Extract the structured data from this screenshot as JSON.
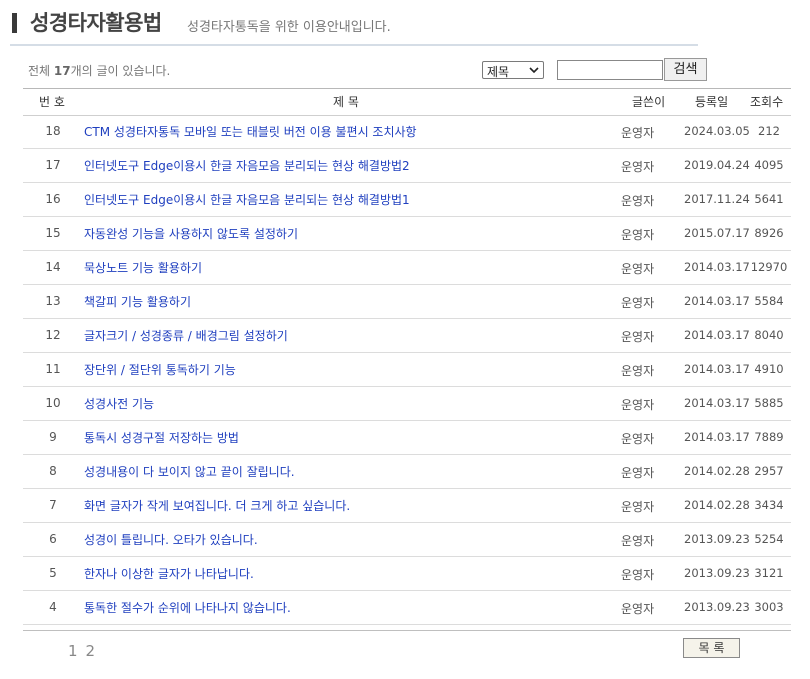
{
  "header": {
    "title": "성경타자활용법",
    "subtitle": "성경타자통독을 위한 이용안내입니다."
  },
  "count": {
    "prefix": "전체 ",
    "number": "17",
    "suffix": "개의 글이 있습니다."
  },
  "search": {
    "field_selected": "제목",
    "input_value": "",
    "button_label": "검색"
  },
  "table": {
    "headers": {
      "num": "번 호",
      "title": "제 목",
      "author": "글쓴이",
      "date": "등록일",
      "hits": "조회수"
    },
    "rows": [
      {
        "num": "18",
        "title": "CTM 성경타자통독 모바일 또는 태블릿 버전 이용 불편시 조치사항",
        "author": "운영자",
        "date": "2024.03.05",
        "hits": "212"
      },
      {
        "num": "17",
        "title": "인터넷도구 Edge이용시 한글 자음모음 분리되는 현상 해결방법2",
        "author": "운영자",
        "date": "2019.04.24",
        "hits": "4095"
      },
      {
        "num": "16",
        "title": "인터넷도구 Edge이용시 한글 자음모음 분리되는 현상 해결방법1",
        "author": "운영자",
        "date": "2017.11.24",
        "hits": "5641"
      },
      {
        "num": "15",
        "title": "자동완성 기능을 사용하지 않도록 설정하기",
        "author": "운영자",
        "date": "2015.07.17",
        "hits": "8926"
      },
      {
        "num": "14",
        "title": "묵상노트 기능 활용하기",
        "author": "운영자",
        "date": "2014.03.17",
        "hits": "12970"
      },
      {
        "num": "13",
        "title": "책갈피 기능 활용하기",
        "author": "운영자",
        "date": "2014.03.17",
        "hits": "5584"
      },
      {
        "num": "12",
        "title": "글자크기 / 성경종류 / 배경그림 설정하기",
        "author": "운영자",
        "date": "2014.03.17",
        "hits": "8040"
      },
      {
        "num": "11",
        "title": "장단위 / 절단위 통독하기 기능",
        "author": "운영자",
        "date": "2014.03.17",
        "hits": "4910"
      },
      {
        "num": "10",
        "title": "성경사전 기능",
        "author": "운영자",
        "date": "2014.03.17",
        "hits": "5885"
      },
      {
        "num": "9",
        "title": "통독시 성경구절 저장하는 방법",
        "author": "운영자",
        "date": "2014.03.17",
        "hits": "7889"
      },
      {
        "num": "8",
        "title": "성경내용이 다 보이지 않고 끝이 잘립니다.",
        "author": "운영자",
        "date": "2014.02.28",
        "hits": "2957"
      },
      {
        "num": "7",
        "title": "화면 글자가 작게 보여집니다. 더 크게 하고 싶습니다.",
        "author": "운영자",
        "date": "2014.02.28",
        "hits": "3434"
      },
      {
        "num": "6",
        "title": "성경이 틀립니다. 오타가 있습니다.",
        "author": "운영자",
        "date": "2013.09.23",
        "hits": "5254"
      },
      {
        "num": "5",
        "title": "한자나 이상한 글자가 나타납니다.",
        "author": "운영자",
        "date": "2013.09.23",
        "hits": "3121"
      },
      {
        "num": "4",
        "title": "통독한 절수가 순위에 나타나지 않습니다.",
        "author": "운영자",
        "date": "2013.09.23",
        "hits": "3003"
      }
    ]
  },
  "pagination": {
    "pages": [
      "1",
      "2"
    ]
  },
  "list_button_label": "목 록",
  "colors": {
    "title_link": "#1f3fbf",
    "header_rule": "#d5dde6"
  }
}
